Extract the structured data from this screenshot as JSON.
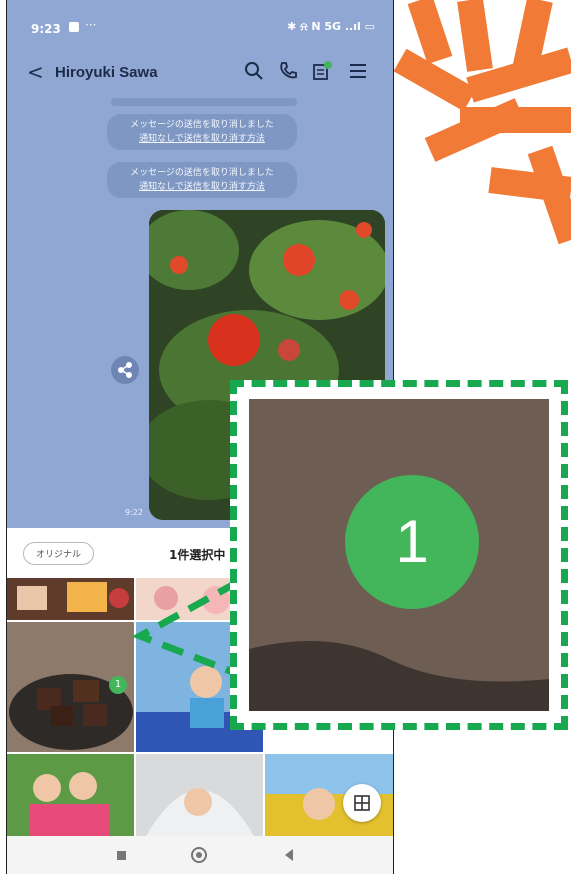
{
  "status_bar": {
    "time": "9:23",
    "more": "···",
    "right_icons": "✱ ⍾ N 5G ..ıl ▭"
  },
  "header": {
    "back_label": "<",
    "title": "Hiroyuki Sawa"
  },
  "chat": {
    "messages": [
      {
        "text": "メッセージの送信を取り消しました",
        "link": "通知なしで送信を取り消す方法"
      },
      {
        "text": "メッセージの送信を取り消しました",
        "link": "通知なしで送信を取り消す方法"
      }
    ],
    "timestamp": "9:22"
  },
  "picker": {
    "original_button": "オリジナル",
    "selection_count": "1件選択中"
  },
  "grid": {
    "selected_number": "1"
  },
  "zoom": {
    "badge_number": "1"
  },
  "colors": {
    "chat_bg": "#8fa7d2",
    "badge_green": "#43b55a",
    "dashed_green": "#18a850",
    "accent_orange": "#f07a36"
  }
}
